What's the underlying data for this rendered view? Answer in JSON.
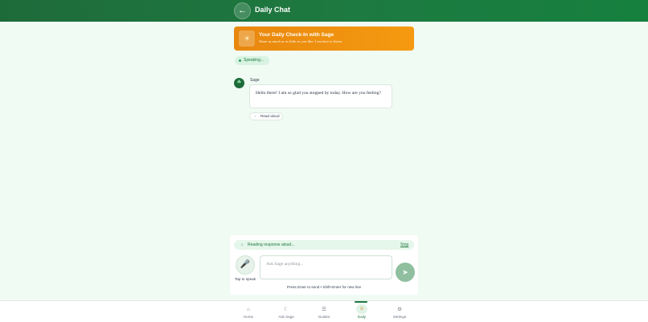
{
  "header": {
    "back_icon": "←",
    "title": "Daily Chat"
  },
  "banner": {
    "icon": "☀",
    "title": "Your Daily Check-In with Sage",
    "subtitle": "Share as much or as little as you like. I am here to listen."
  },
  "status": {
    "speaking_label": "Speaking..."
  },
  "messages": [
    {
      "avatar_icon": "☘",
      "sender": "Sage",
      "text": "Hello there! I am so glad you stopped by today. How are you feeling?",
      "read_aloud_label": "Read aloud",
      "read_aloud_icon": "♪"
    }
  ],
  "reading": {
    "icon": "♫",
    "text": "Reading response aloud...",
    "stop_label": "Stop"
  },
  "composer": {
    "mic_icon": "🎤",
    "mic_label": "Tap to speak",
    "placeholder": "Ask Sage anything...",
    "send_icon": "➤",
    "hint": "Press Enter to send • Shift+Enter for new line"
  },
  "nav": {
    "items": [
      {
        "label": "Home",
        "icon": "⌂"
      },
      {
        "label": "Ask Sage",
        "icon": "☾"
      },
      {
        "label": "Guides",
        "icon": "☰"
      },
      {
        "label": "Daily",
        "icon": "☺",
        "active": true
      },
      {
        "label": "Settings",
        "icon": "⚙"
      }
    ]
  },
  "colors": {
    "header": "#1e6b3a",
    "banner": "#f59a10",
    "accent": "#1e7a42",
    "background": "#f0fbf4"
  }
}
